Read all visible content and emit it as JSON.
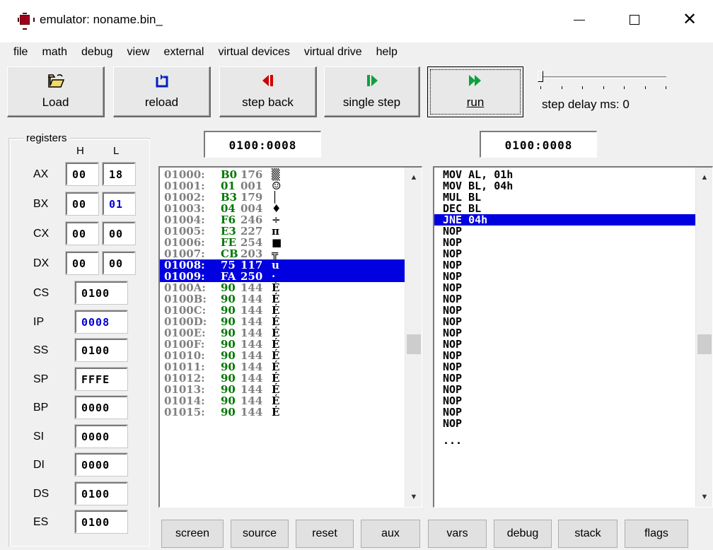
{
  "window": {
    "title": "emulator: noname.bin_"
  },
  "menu": [
    "file",
    "math",
    "debug",
    "view",
    "external",
    "virtual devices",
    "virtual drive",
    "help"
  ],
  "toolbar": {
    "load": "Load",
    "reload": "reload",
    "step_back": "step back",
    "single_step": "single step",
    "run": "run",
    "step_delay": "step delay ms: 0",
    "step_delay_value": 0
  },
  "icons": {
    "load": "folder-open-icon",
    "reload": "reload-icon",
    "step_back": "step-back-icon",
    "single_step": "single-step-icon",
    "run": "run-icon"
  },
  "colors": {
    "selection": "#0000e0",
    "hex_byte": "#007700",
    "address": "#808080",
    "changed_value": "#0000cc"
  },
  "registers": {
    "title": "registers",
    "h_label": "H",
    "l_label": "L",
    "split": [
      {
        "name": "AX",
        "h": "00",
        "l": "18"
      },
      {
        "name": "BX",
        "h": "00",
        "l": "01"
      },
      {
        "name": "CX",
        "h": "00",
        "l": "00"
      },
      {
        "name": "DX",
        "h": "00",
        "l": "00"
      }
    ],
    "full": [
      {
        "name": "CS",
        "value": "0100"
      },
      {
        "name": "IP",
        "value": "0008"
      },
      {
        "name": "SS",
        "value": "0100"
      },
      {
        "name": "SP",
        "value": "FFFE"
      },
      {
        "name": "BP",
        "value": "0000"
      },
      {
        "name": "SI",
        "value": "0000"
      },
      {
        "name": "DI",
        "value": "0000"
      },
      {
        "name": "DS",
        "value": "0100"
      },
      {
        "name": "ES",
        "value": "0100"
      }
    ]
  },
  "memory": {
    "address": "0100:0008",
    "rows": [
      {
        "addr": "01000:",
        "hex": "B0",
        "dec": "176",
        "ch": "▒"
      },
      {
        "addr": "01001:",
        "hex": "01",
        "dec": "001",
        "ch": "☺"
      },
      {
        "addr": "01002:",
        "hex": "B3",
        "dec": "179",
        "ch": "│"
      },
      {
        "addr": "01003:",
        "hex": "04",
        "dec": "004",
        "ch": "♦"
      },
      {
        "addr": "01004:",
        "hex": "F6",
        "dec": "246",
        "ch": "÷"
      },
      {
        "addr": "01005:",
        "hex": "E3",
        "dec": "227",
        "ch": "π"
      },
      {
        "addr": "01006:",
        "hex": "FE",
        "dec": "254",
        "ch": "■"
      },
      {
        "addr": "01007:",
        "hex": "CB",
        "dec": "203",
        "ch": "╦"
      },
      {
        "addr": "01008:",
        "hex": "75",
        "dec": "117",
        "ch": "u",
        "selected": true
      },
      {
        "addr": "01009:",
        "hex": "FA",
        "dec": "250",
        "ch": "·",
        "selected": true
      },
      {
        "addr": "0100A:",
        "hex": "90",
        "dec": "144",
        "ch": "É"
      },
      {
        "addr": "0100B:",
        "hex": "90",
        "dec": "144",
        "ch": "É"
      },
      {
        "addr": "0100C:",
        "hex": "90",
        "dec": "144",
        "ch": "É"
      },
      {
        "addr": "0100D:",
        "hex": "90",
        "dec": "144",
        "ch": "É"
      },
      {
        "addr": "0100E:",
        "hex": "90",
        "dec": "144",
        "ch": "É"
      },
      {
        "addr": "0100F:",
        "hex": "90",
        "dec": "144",
        "ch": "É"
      },
      {
        "addr": "01010:",
        "hex": "90",
        "dec": "144",
        "ch": "É"
      },
      {
        "addr": "01011:",
        "hex": "90",
        "dec": "144",
        "ch": "É"
      },
      {
        "addr": "01012:",
        "hex": "90",
        "dec": "144",
        "ch": "É"
      },
      {
        "addr": "01013:",
        "hex": "90",
        "dec": "144",
        "ch": "É"
      },
      {
        "addr": "01014:",
        "hex": "90",
        "dec": "144",
        "ch": "É"
      },
      {
        "addr": "01015:",
        "hex": "90",
        "dec": "144",
        "ch": "É"
      }
    ]
  },
  "disasm": {
    "address": "0100:0008",
    "rows": [
      {
        "text": "MOV AL, 01h"
      },
      {
        "text": "MOV BL, 04h"
      },
      {
        "text": "MUL BL"
      },
      {
        "text": "DEC BL"
      },
      {
        "text": "JNE 04h",
        "selected": true
      },
      {
        "text": "NOP"
      },
      {
        "text": "NOP"
      },
      {
        "text": "NOP"
      },
      {
        "text": "NOP"
      },
      {
        "text": "NOP"
      },
      {
        "text": "NOP"
      },
      {
        "text": "NOP"
      },
      {
        "text": "NOP"
      },
      {
        "text": "NOP"
      },
      {
        "text": "NOP"
      },
      {
        "text": "NOP"
      },
      {
        "text": "NOP"
      },
      {
        "text": "NOP"
      },
      {
        "text": "NOP"
      },
      {
        "text": "NOP"
      },
      {
        "text": "NOP"
      },
      {
        "text": "NOP"
      },
      {
        "text": "NOP"
      },
      {
        "text": "..."
      }
    ]
  },
  "bottom_buttons": [
    "screen",
    "source",
    "reset",
    "aux",
    "vars",
    "debug",
    "stack",
    "flags"
  ]
}
